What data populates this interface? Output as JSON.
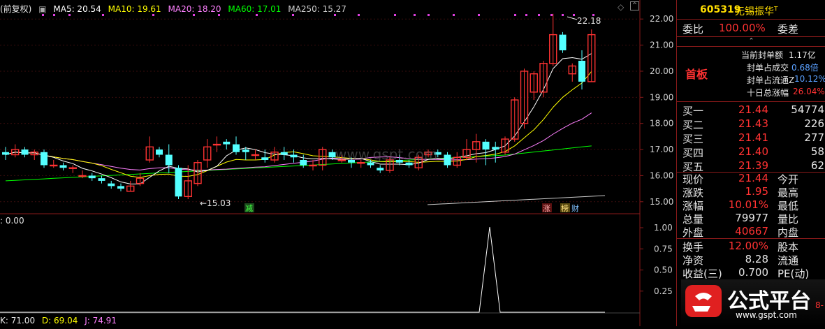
{
  "indicator_header": {
    "prefix": "(前复权)",
    "ma5": "MA5: 20.54",
    "ma10": "MA10: 19.61",
    "ma20": "MA20: 18.20",
    "ma60": "MA60: 17.01",
    "ma250": "MA250: 15.27"
  },
  "lower_header": ": 0.00",
  "kdj": {
    "k": "K: 71.00",
    "d": "D: 69.04",
    "j": "J: 74.91"
  },
  "annotations": {
    "high": "22.18",
    "low": "←15.03",
    "reduce_badge": "减",
    "tag_zhang": "涨",
    "tag_bang": "榜",
    "tag_cai": "财",
    "watermark": "www.gspt.com"
  },
  "price_axis": {
    "ticks": [
      "22.00",
      "21.00",
      "20.00",
      "19.00",
      "18.00",
      "17.00",
      "16.00",
      "15.00"
    ]
  },
  "lower_axis": {
    "ticks": [
      "1.00",
      "0.75",
      "0.50",
      "0.25"
    ]
  },
  "colors": {
    "up": "#ff3232",
    "down": "#54ffff",
    "ma5": "#ffffff",
    "ma10": "#ffff00",
    "ma20": "#ff80ff",
    "ma60": "#00ff00",
    "ma250": "#cccccc",
    "border": "#8a1a1a"
  },
  "stock": {
    "code": "605319",
    "name": "无锡振华",
    "suffix": "T"
  },
  "wei": {
    "label1": "委比",
    "value": "100.00%",
    "label2": "委差"
  },
  "limit_up": {
    "badge": "首板",
    "items": [
      {
        "label": "当前封单额",
        "value": "1.17亿"
      },
      {
        "label": "封单占成交",
        "value": "0.68倍"
      },
      {
        "label": "封单占流通Z",
        "value": "10.12%"
      },
      {
        "label": "十日总涨幅",
        "value": "26.04%"
      }
    ]
  },
  "bids": [
    {
      "label": "买一",
      "price": "21.44",
      "vol": "54774"
    },
    {
      "label": "买二",
      "price": "21.43",
      "vol": "226"
    },
    {
      "label": "买三",
      "price": "21.41",
      "vol": "277"
    },
    {
      "label": "买四",
      "price": "21.40",
      "vol": "58"
    },
    {
      "label": "买五",
      "price": "21.39",
      "vol": "62"
    }
  ],
  "quote": [
    {
      "l1": "现价",
      "v1": "21.44",
      "l2": "今开"
    },
    {
      "l1": "涨跌",
      "v1": "1.95",
      "l2": "最高"
    },
    {
      "l1": "涨幅",
      "v1": "10.01%",
      "l2": "最低"
    },
    {
      "l1": "总量",
      "v1": "79977",
      "l2": "量比"
    },
    {
      "l1": "外盘",
      "v1": "40667",
      "l2": "内盘"
    }
  ],
  "stats": [
    {
      "l1": "换手",
      "v1": "12.00%",
      "l2": "股本"
    },
    {
      "l1": "净资",
      "v1": "8.28",
      "l2": "流通"
    },
    {
      "l1": "收益(三)",
      "v1": "0.700",
      "l2": "PE(动)"
    }
  ],
  "brand": {
    "name": "公式平台",
    "url": "www.gspt.com",
    "edge": "8-"
  },
  "chart_data": {
    "type": "candlestick",
    "ylim": [
      14.7,
      22.3
    ],
    "candles": [
      [
        16.9,
        16.8,
        17.1,
        16.6
      ],
      [
        16.8,
        17.0,
        17.2,
        16.7
      ],
      [
        17.0,
        16.8,
        17.1,
        16.7
      ],
      [
        16.8,
        16.9,
        17.0,
        16.6
      ],
      [
        16.9,
        16.4,
        17.0,
        16.3
      ],
      [
        16.4,
        16.4,
        16.6,
        16.3
      ],
      [
        16.4,
        16.3,
        16.5,
        16.2
      ],
      [
        16.3,
        16.3,
        16.4,
        16.1
      ],
      [
        16.0,
        16.0,
        16.2,
        15.9
      ],
      [
        16.0,
        15.9,
        16.1,
        15.8
      ],
      [
        15.9,
        15.8,
        16.0,
        15.7
      ],
      [
        15.7,
        15.6,
        15.8,
        15.5
      ],
      [
        15.6,
        15.5,
        15.7,
        15.4
      ],
      [
        15.4,
        15.6,
        15.8,
        15.4
      ],
      [
        15.7,
        15.9,
        16.1,
        15.6
      ],
      [
        16.6,
        17.1,
        17.5,
        16.5
      ],
      [
        17.0,
        16.8,
        17.1,
        16.7
      ],
      [
        16.8,
        16.4,
        17.2,
        16.1
      ],
      [
        16.3,
        15.2,
        16.4,
        15.1
      ],
      [
        15.2,
        15.8,
        16.4,
        15.1
      ],
      [
        15.7,
        16.5,
        16.6,
        15.6
      ],
      [
        16.6,
        17.1,
        17.4,
        16.3
      ],
      [
        17.2,
        17.2,
        17.5,
        16.9
      ],
      [
        17.3,
        17.2,
        17.4,
        17.0
      ],
      [
        17.2,
        16.9,
        17.5,
        16.8
      ],
      [
        17.0,
        16.9,
        17.1,
        16.6
      ],
      [
        16.8,
        16.8,
        17.0,
        16.6
      ],
      [
        16.7,
        16.6,
        17.0,
        16.5
      ],
      [
        16.6,
        16.9,
        17.1,
        16.5
      ],
      [
        16.9,
        16.8,
        17.1,
        16.6
      ],
      [
        16.8,
        16.7,
        17.0,
        16.5
      ],
      [
        16.6,
        16.4,
        16.8,
        16.3
      ],
      [
        16.4,
        16.4,
        16.6,
        16.2
      ],
      [
        16.4,
        17.0,
        17.1,
        16.2
      ],
      [
        16.9,
        16.7,
        17.0,
        16.6
      ],
      [
        16.6,
        16.6,
        16.8,
        16.5
      ],
      [
        16.6,
        16.5,
        16.7,
        16.3
      ],
      [
        16.5,
        16.5,
        16.6,
        16.3
      ],
      [
        16.5,
        16.4,
        16.6,
        16.3
      ],
      [
        16.3,
        16.2,
        16.4,
        16.1
      ],
      [
        16.2,
        16.6,
        16.7,
        16.1
      ],
      [
        16.6,
        16.5,
        16.8,
        16.4
      ],
      [
        16.5,
        16.4,
        16.6,
        16.3
      ],
      [
        16.3,
        16.7,
        16.8,
        16.2
      ],
      [
        16.8,
        16.9,
        17.0,
        16.7
      ],
      [
        16.9,
        16.8,
        17.0,
        16.7
      ],
      [
        16.8,
        16.4,
        16.9,
        16.3
      ],
      [
        16.4,
        16.7,
        16.9,
        16.3
      ],
      [
        16.7,
        17.0,
        17.4,
        16.6
      ],
      [
        17.0,
        17.3,
        17.6,
        16.5
      ],
      [
        17.3,
        17.0,
        17.4,
        16.4
      ],
      [
        17.1,
        17.0,
        17.3,
        16.5
      ],
      [
        16.9,
        17.4,
        17.5,
        16.8
      ],
      [
        17.4,
        18.9,
        19.0,
        17.3
      ],
      [
        18.0,
        20.0,
        20.1,
        17.8
      ],
      [
        19.2,
        19.9,
        20.0,
        18.9
      ],
      [
        19.2,
        20.3,
        20.4,
        19.0
      ],
      [
        20.3,
        21.4,
        22.2,
        20.2
      ],
      [
        21.4,
        20.8,
        21.5,
        20.7
      ],
      [
        19.9,
        20.2,
        20.3,
        19.6
      ],
      [
        20.4,
        19.6,
        20.8,
        19.3
      ],
      [
        19.6,
        21.4,
        21.6,
        19.6
      ]
    ]
  }
}
